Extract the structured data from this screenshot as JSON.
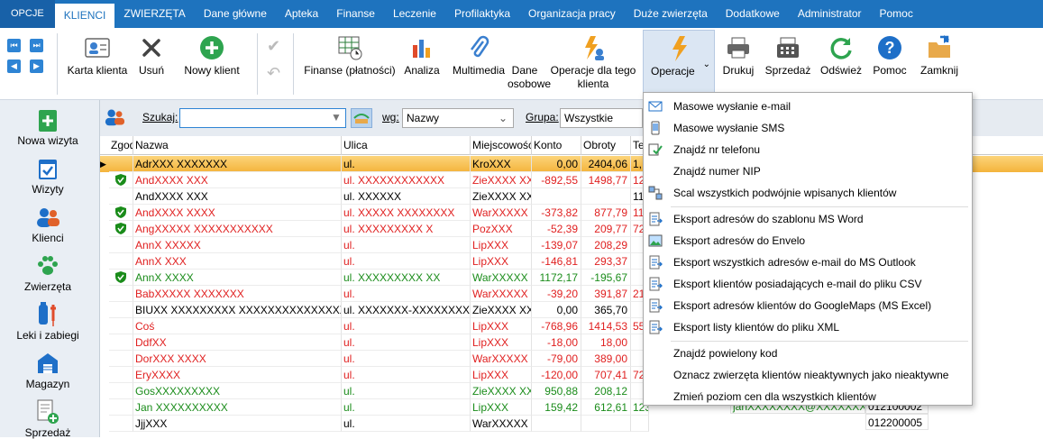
{
  "menubar": {
    "tabs": [
      "OPCJE",
      "KLIENCI",
      "ZWIERZĘTA",
      "Dane główne",
      "Apteka",
      "Finanse",
      "Leczenie",
      "Profilaktyka",
      "Organizacja pracy",
      "Duże zwierzęta",
      "Dodatkowe",
      "Administrator",
      "Pomoc"
    ]
  },
  "ribbon": {
    "karta": "Karta klienta",
    "usun": "Usuń",
    "nowy": "Nowy klient",
    "finanse": "Finanse (płatności)",
    "analiza": "Analiza",
    "multimedia1": "Multimedia",
    "multimedia2": "",
    "dane1": "Dane",
    "dane2": "osobowe",
    "operacje_dla1": "Operacje dla tego",
    "operacje_dla2": "klienta",
    "operacje": "Operacje",
    "drukuj": "Drukuj",
    "sprzedaz": "Sprzedaż",
    "odswiez": "Odśwież",
    "pomoc": "Pomoc",
    "zamknij": "Zamknij"
  },
  "sidebar": {
    "items": [
      "Nowa wizyta",
      "Wizyty",
      "Klienci",
      "Zwierzęta",
      "Leki i zabiegi",
      "Magazyn",
      "Sprzedaż"
    ]
  },
  "search": {
    "label": "Szukaj:",
    "value": "",
    "wg_label": "wg:",
    "wg_value": "Nazwy",
    "grupa_label": "Grupa:",
    "grupa_value": "Wszystkie"
  },
  "grid": {
    "headers": [
      "Zgoda",
      "Nazwa",
      "Ulica",
      "Miejscowość",
      "Konto",
      "Obroty",
      "Te"
    ],
    "rows": [
      {
        "shield": false,
        "name": "AdrXXX XXXXXXX",
        "street": "ul.",
        "city": "KroXXX",
        "konto": "0,00",
        "obroty": "2404,06",
        "te": "1,",
        "color": "#000",
        "selected": true
      },
      {
        "shield": true,
        "name": "AndXXXX XXX",
        "street": "ul. XXXXXXXXXXXX",
        "city": "ZieXXXX XXX",
        "konto": "-892,55",
        "obroty": "1498,77",
        "te": "12",
        "color": "#e02020"
      },
      {
        "shield": false,
        "name": "AndXXXX XXX",
        "street": "ul. XXXXXX",
        "city": "ZieXXXX XXX",
        "konto": "",
        "obroty": "",
        "te": "11",
        "color": "#000"
      },
      {
        "shield": true,
        "name": "AndXXXX XXXX",
        "street": "ul. XXXXX XXXXXXXX",
        "city": "WarXXXXX",
        "konto": "-373,82",
        "obroty": "877,79",
        "te": "11",
        "color": "#e02020"
      },
      {
        "shield": true,
        "name": "AngXXXXX XXXXXXXXXXX",
        "street": "ul. XXXXXXXXX X",
        "city": "PozXXX",
        "konto": "-52,39",
        "obroty": "209,77",
        "te": "72",
        "color": "#e02020"
      },
      {
        "shield": false,
        "name": "AnnX XXXXX",
        "street": "ul.",
        "city": "LipXXX",
        "konto": "-139,07",
        "obroty": "208,29",
        "te": "",
        "color": "#e02020"
      },
      {
        "shield": false,
        "name": "AnnX XXX",
        "street": "ul.",
        "city": "LipXXX",
        "konto": "-146,81",
        "obroty": "293,37",
        "te": "",
        "color": "#e02020"
      },
      {
        "shield": true,
        "name": "AnnX XXXX",
        "street": "ul. XXXXXXXXX XX",
        "city": "WarXXXXX",
        "konto": "1172,17",
        "obroty": "-195,67",
        "te": "",
        "color": "#1a8c1a"
      },
      {
        "shield": false,
        "name": "BabXXXXX XXXXXXX",
        "street": "ul.",
        "city": "WarXXXXX",
        "konto": "-39,20",
        "obroty": "391,87",
        "te": "21",
        "color": "#e02020"
      },
      {
        "shield": false,
        "name": "BIUXX XXXXXXXXX XXXXXXXXXXXXXXX XXX",
        "street": "ul. XXXXXXX-XXXXXXXXX",
        "city": "ZieXXXX XXX",
        "konto": "0,00",
        "obroty": "365,70",
        "te": "",
        "color": "#000"
      },
      {
        "shield": false,
        "name": "Coś",
        "street": "ul.",
        "city": "LipXXX",
        "konto": "-768,96",
        "obroty": "1414,53",
        "te": "55",
        "color": "#e02020"
      },
      {
        "shield": false,
        "name": "DdfXX",
        "street": "ul.",
        "city": "LipXXX",
        "konto": "-18,00",
        "obroty": "18,00",
        "te": "",
        "color": "#e02020"
      },
      {
        "shield": false,
        "name": "DorXXX XXXX",
        "street": "ul.",
        "city": "WarXXXXX",
        "konto": "-79,00",
        "obroty": "389,00",
        "te": "",
        "color": "#e02020"
      },
      {
        "shield": false,
        "name": "EryXXXX",
        "street": "ul.",
        "city": "LipXXX",
        "konto": "-120,00",
        "obroty": "707,41",
        "te": "72",
        "color": "#e02020"
      },
      {
        "shield": false,
        "name": "GosXXXXXXXXX",
        "street": "ul.",
        "city": "ZieXXXX XXX",
        "konto": "950,88",
        "obroty": "208,12",
        "te": "",
        "color": "#1a8c1a"
      },
      {
        "shield": false,
        "name": "Jan XXXXXXXXXX",
        "street": "ul.",
        "city": "LipXXX",
        "konto": "159,42",
        "obroty": "612,61",
        "te": "123XXXX",
        "color": "#1a8c1a"
      },
      {
        "shield": false,
        "name": "JjjXXX",
        "street": "ul.",
        "city": "WarXXXXX",
        "konto": "",
        "obroty": "",
        "te": "",
        "color": "#000"
      }
    ],
    "extra_email": "janXXXXXXXX@XXXXXXXX.XX",
    "extra_code1": "012100002",
    "extra_code2": "012200005"
  },
  "operacje_menu": {
    "items": [
      {
        "label": "Masowe wysłanie e-mail",
        "icon": "envelope-icon"
      },
      {
        "label": "Masowe wysłanie SMS",
        "icon": "phone-sms-icon"
      },
      {
        "label": "Znajdź nr telefonu",
        "icon": "check-list-icon"
      },
      {
        "label": "Znajdź numer NIP",
        "icon": ""
      },
      {
        "label": "Scal wszystkich podwójnie wpisanych klientów",
        "icon": "merge-icon"
      },
      {
        "label": "Eksport adresów do szablonu MS Word",
        "icon": "export-word-icon"
      },
      {
        "label": "Eksport adresów do Envelo",
        "icon": "image-icon"
      },
      {
        "label": "Eksport wszystkich adresów e-mail do MS Outlook",
        "icon": "export-outlook-icon"
      },
      {
        "label": "Eksport klientów posiadających e-mail do pliku CSV",
        "icon": "export-csv-icon"
      },
      {
        "label": "Eksport adresów klientów do GoogleMaps (MS Excel)",
        "icon": "export-excel-icon"
      },
      {
        "label": "Eksport listy klientów do pliku XML",
        "icon": "export-xml-icon"
      },
      {
        "label": "Znajdź powielony kod",
        "icon": ""
      },
      {
        "label": "Oznacz zwierzęta klientów nieaktywnych jako nieaktywne",
        "icon": ""
      },
      {
        "label": "Zmień poziom cen dla wszystkich klientów",
        "icon": ""
      }
    ]
  }
}
